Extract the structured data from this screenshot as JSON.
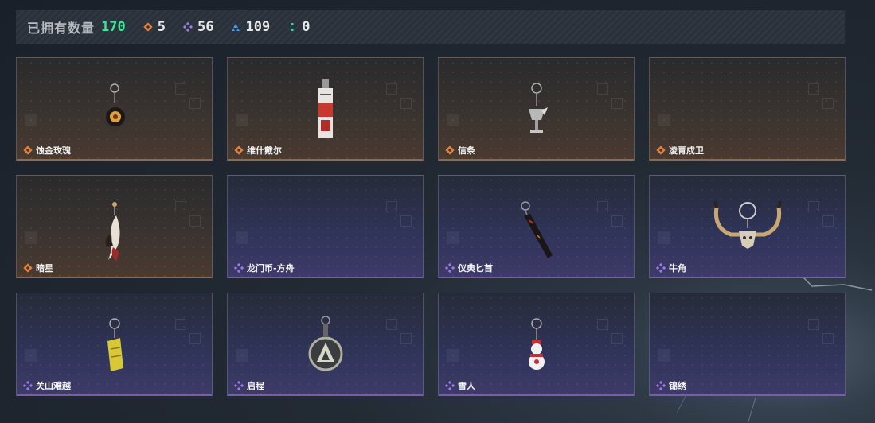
{
  "header": {
    "owned_label": "已拥有数量",
    "owned_count": "170",
    "stats": [
      {
        "icon": "orange-diamond-icon",
        "color": "#e0823e",
        "value": "5"
      },
      {
        "icon": "purple-diamond-icon",
        "color": "#9a7ce0",
        "value": "56"
      },
      {
        "icon": "blue-triangle-icon",
        "color": "#4a9ae0",
        "value": "109"
      },
      {
        "icon": "green-dots-icon",
        "color": "#3ad0a0",
        "value": "0"
      }
    ]
  },
  "items": [
    {
      "name": "蚀金玫瑰",
      "rarity": "orange",
      "icon": "rose-keychain-icon"
    },
    {
      "name": "维什戴尔",
      "rarity": "orange",
      "icon": "card-keychain-icon"
    },
    {
      "name": "信条",
      "rarity": "orange",
      "icon": "goblet-keychain-icon"
    },
    {
      "name": "凌青戍卫",
      "rarity": "orange",
      "icon": "empty-slot"
    },
    {
      "name": "暗星",
      "rarity": "orange",
      "icon": "feather-keychain-icon"
    },
    {
      "name": "龙门币-方舟",
      "rarity": "purple",
      "icon": "empty-slot"
    },
    {
      "name": "仪典匕首",
      "rarity": "purple",
      "icon": "dagger-keychain-icon"
    },
    {
      "name": "牛角",
      "rarity": "purple",
      "icon": "horn-keychain-icon"
    },
    {
      "name": "关山难越",
      "rarity": "purple",
      "icon": "lighter-keychain-icon"
    },
    {
      "name": "启程",
      "rarity": "purple",
      "icon": "medal-keychain-icon"
    },
    {
      "name": "雪人",
      "rarity": "purple",
      "icon": "snowman-keychain-icon"
    },
    {
      "name": "锦绣",
      "rarity": "purple",
      "icon": "empty-slot"
    }
  ],
  "colors": {
    "orange_rarity": "#e0823e",
    "purple_rarity": "#9a7ce0",
    "owned_count": "#38e89a"
  }
}
